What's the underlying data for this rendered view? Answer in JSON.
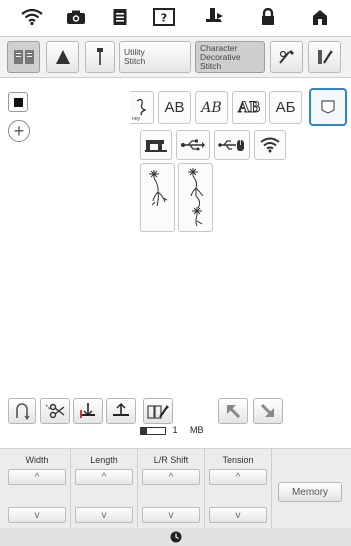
{
  "top_icons": [
    "wifi-icon",
    "camera-icon",
    "document-icon",
    "help-icon",
    "presser-foot-icon",
    "lock-icon",
    "home-icon"
  ],
  "tabs": {
    "book_icon": "book-icon",
    "needle_triangle_icon": "needle-triangle-icon",
    "needle_icon": "needle-icon",
    "utility_label_1": "Utility",
    "utility_label_2": "Stitch",
    "character_label_1": "Character",
    "character_label_2": "Decorative",
    "character_label_3": "Stitch",
    "edit_icon": "edit-pen-icon",
    "settings_icon": "settings-pen-icon"
  },
  "font_tiles": [
    "AB",
    "AB",
    "AB",
    "AБ"
  ],
  "font_partial_label": "ney",
  "memory": {
    "size": "1",
    "unit": "MB"
  },
  "params": {
    "width_label": "Width",
    "length_label": "Length",
    "lr_shift_label": "L/R Shift",
    "tension_label": "Tension",
    "up_glyph": "^",
    "down_glyph": "v"
  },
  "memory_button_label": "Memory",
  "colors": {
    "selected_border": "#2f84d8",
    "panel_bg": "#ececec"
  }
}
